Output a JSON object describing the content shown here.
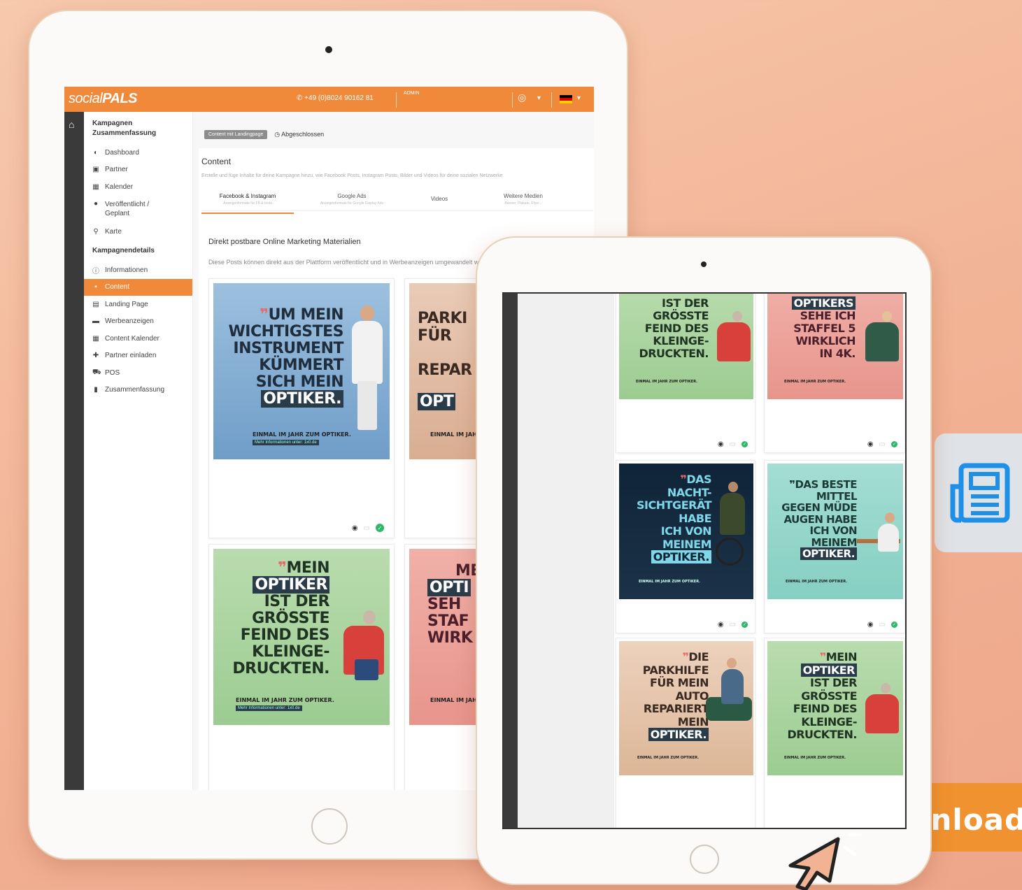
{
  "app": {
    "logo_regular": "social",
    "logo_bold": "PALS",
    "phone": "+49 (0)8024 90162 81",
    "admin": "ADMIN"
  },
  "sidebar": {
    "summary_heading": "Kampagnen Zusammenfassung",
    "summary_items": [
      {
        "label": "Dashboard",
        "icon": "dashboard-icon"
      },
      {
        "label": "Partner",
        "icon": "partner-icon"
      },
      {
        "label": "Kalender",
        "icon": "calendar-icon"
      },
      {
        "label": "Veröffentlicht / Geplant",
        "icon": "published-icon"
      },
      {
        "label": "Karte",
        "icon": "map-pin-icon"
      }
    ],
    "details_heading": "Kampagnendetails",
    "detail_items": [
      {
        "label": "Informationen",
        "icon": "info-icon"
      },
      {
        "label": "Content",
        "icon": "content-icon",
        "active": true
      },
      {
        "label": "Landing Page",
        "icon": "landing-page-icon"
      },
      {
        "label": "Werbeanzeigen",
        "icon": "ads-icon"
      },
      {
        "label": "Content Kalender",
        "icon": "calendar-icon"
      },
      {
        "label": "Partner einladen",
        "icon": "invite-icon"
      },
      {
        "label": "POS",
        "icon": "cart-icon"
      },
      {
        "label": "Zusammenfassung",
        "icon": "summary-icon"
      }
    ]
  },
  "main": {
    "badge": "Content mit Landingpage",
    "status": "Abgeschlossen",
    "title": "Content",
    "subtitle": "Erstelle und füge Inhalte für deine Kampagne hinzu, wie Facebook Posts, Instagram Posts, Bilder und Videos für deine sozialen Netzwerke",
    "tabs": [
      {
        "label": "Facebook & Instagram",
        "sub": "Anzeigenformate für FB & Insta",
        "active": true
      },
      {
        "label": "Google Ads",
        "sub": "Anzeigenformate für Google Display Ads"
      },
      {
        "label": "Videos",
        "sub": ""
      },
      {
        "label": "Weitere Medien",
        "sub": "Banner, Plakate, Flyer..."
      }
    ],
    "section_title": "Direkt postbare Online Marketing Materialien",
    "section_sub": "Diese Posts können direkt aus der Plattform veröffentlicht und in Werbeanzeigen umgewandelt werden"
  },
  "posters": {
    "tagline": "EINMAL IM JAHR ZUM OPTIKER.",
    "fine": "Mehr Informationen unter: 1x0.de",
    "large_1": [
      "UM MEIN",
      "WICHTIGSTES",
      "INSTRUMENT",
      "KÜMMERT",
      "SICH MEIN",
      "OPTIKER."
    ],
    "large_2": [
      "PARKI",
      "FÜR",
      "REPAR",
      "OPT"
    ],
    "large_3": [
      "MEIN",
      "OPTIKER",
      "IST DER",
      "GRÖSSTE",
      "FEIND DES",
      "KLEINGE-",
      "DRUCKTEN."
    ],
    "large_4": [
      "ME",
      "OPTI",
      "SEH",
      "STAF",
      "WIRK"
    ],
    "small_1": [
      "IST DER",
      "GRÖSSTE",
      "FEIND DES",
      "KLEINGE-",
      "DRUCKTEN."
    ],
    "small_2": [
      "OPTIKERS",
      "SEHE ICH",
      "STAFFEL 5",
      "WIRKLICH",
      "IN 4K."
    ],
    "small_3": [
      "DAS",
      "NACHT-",
      "SICHTGERÄT",
      "HABE",
      "ICH VON",
      "MEINEM",
      "OPTIKER."
    ],
    "small_4": [
      "DAS BESTE",
      "MITTEL",
      "GEGEN MÜDE",
      "AUGEN HABE",
      "ICH VON",
      "MEINEM",
      "OPTIKER."
    ],
    "small_5": [
      "DIE",
      "PARKHILFE",
      "FÜR MEIN",
      "AUTO",
      "REPARIERT",
      "MEIN",
      "OPTIKER."
    ],
    "small_6": [
      "MEIN",
      "OPTIKER",
      "IST DER",
      "GRÖSSTE",
      "FEIND DES",
      "KLEINGE-",
      "DRUCKTEN."
    ]
  },
  "cta": {
    "download": "Download"
  },
  "colors": {
    "brand_orange": "#f08a3a",
    "background": "#f4b898",
    "approved_green": "#2eb86b"
  }
}
